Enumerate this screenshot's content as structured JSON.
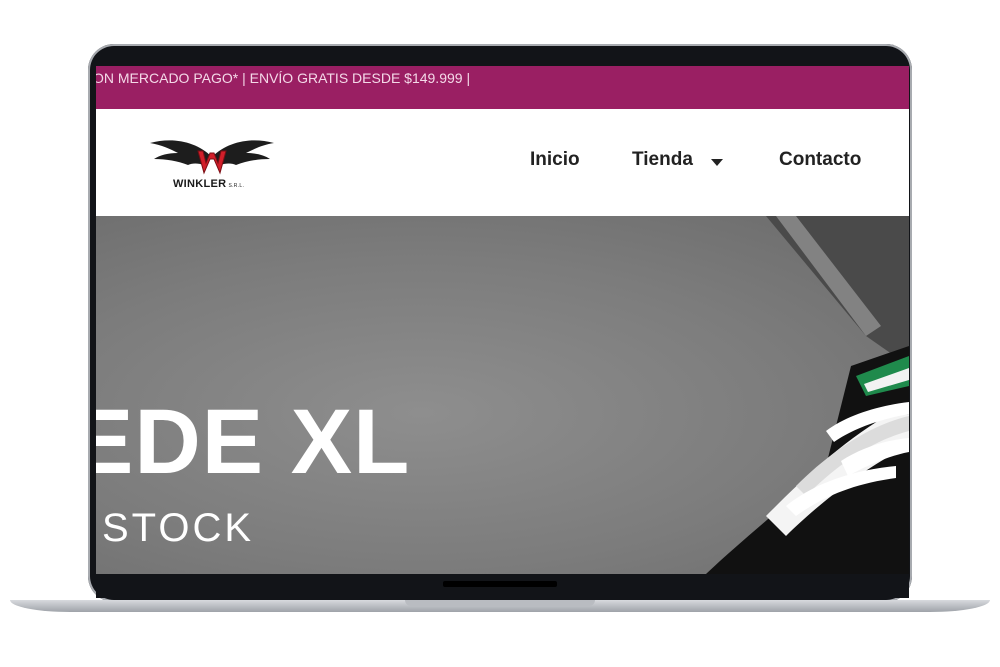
{
  "promo": {
    "text": "ON MERCADO PAGO* | ENVÍO GRATIS DESDE $149.999 |"
  },
  "brand": {
    "name": "WINKLER",
    "suffix": "S.R.L."
  },
  "nav": {
    "items": [
      {
        "label": "Inicio"
      },
      {
        "label": "Tienda"
      },
      {
        "label": "Contacto"
      }
    ]
  },
  "hero": {
    "title": "EDE XL",
    "subtitle": "STOCK"
  },
  "colors": {
    "promo_bar": "#9a1f63",
    "logo_red": "#d21f2a"
  }
}
